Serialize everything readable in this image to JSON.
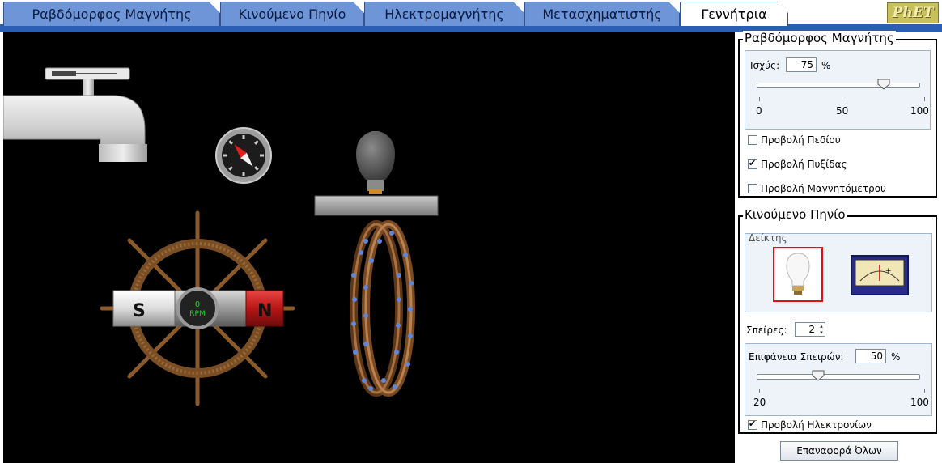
{
  "tabs": [
    {
      "label": "Ραβδόμορφος Μαγνήτης"
    },
    {
      "label": "Κινούμενο Πηνίο"
    },
    {
      "label": "Ηλεκτρομαγνήτης"
    },
    {
      "label": "Μετασχηματιστής"
    },
    {
      "label": "Γεννήτρια",
      "selected": true
    }
  ],
  "logo_text": "PhET",
  "simulation": {
    "magnet_south_label": "S",
    "magnet_north_label": "N",
    "rpm_value": "0",
    "rpm_unit": "RPM"
  },
  "bar_magnet_panel": {
    "title": "Ραβδόμορφος Μαγνήτης",
    "strength_label": "Ισχύς:",
    "strength_value": "75",
    "strength_unit": "%",
    "strength_level": 0.75,
    "tick_min": "0",
    "tick_mid": "50",
    "tick_max": "100",
    "show_field_label": "Προβολή Πεδίου",
    "show_field_checked": false,
    "show_compass_label": "Προβολή Πυξίδας",
    "show_compass_checked": true,
    "show_meter_label": "Προβολή Μαγνητόμετρου",
    "show_meter_checked": false
  },
  "pickup_coil_panel": {
    "title": "Κινούμενο Πηνίο",
    "indicator_title": "Δείκτης",
    "loops_label": "Σπείρες:",
    "loops_value": "2",
    "loop_area_label": "Επιφάνεια Σπειρών:",
    "loop_area_value": "50",
    "loop_area_unit": "%",
    "loop_area_level": 0.375,
    "tick_min": "20",
    "tick_max": "100",
    "show_electrons_label": "Προβολή Ηλεκτρονίων",
    "show_electrons_checked": true
  },
  "reset_all_label": "Επαναφορά Όλων",
  "colors": {
    "tab_bg": "#6f95d9",
    "tab_line": "#2b5fb3",
    "magnet_north": "#c41a1a",
    "magnet_south": "#e6e6e6",
    "wood": "#8a5a2b",
    "indicator_selected_border": "#e01010"
  }
}
